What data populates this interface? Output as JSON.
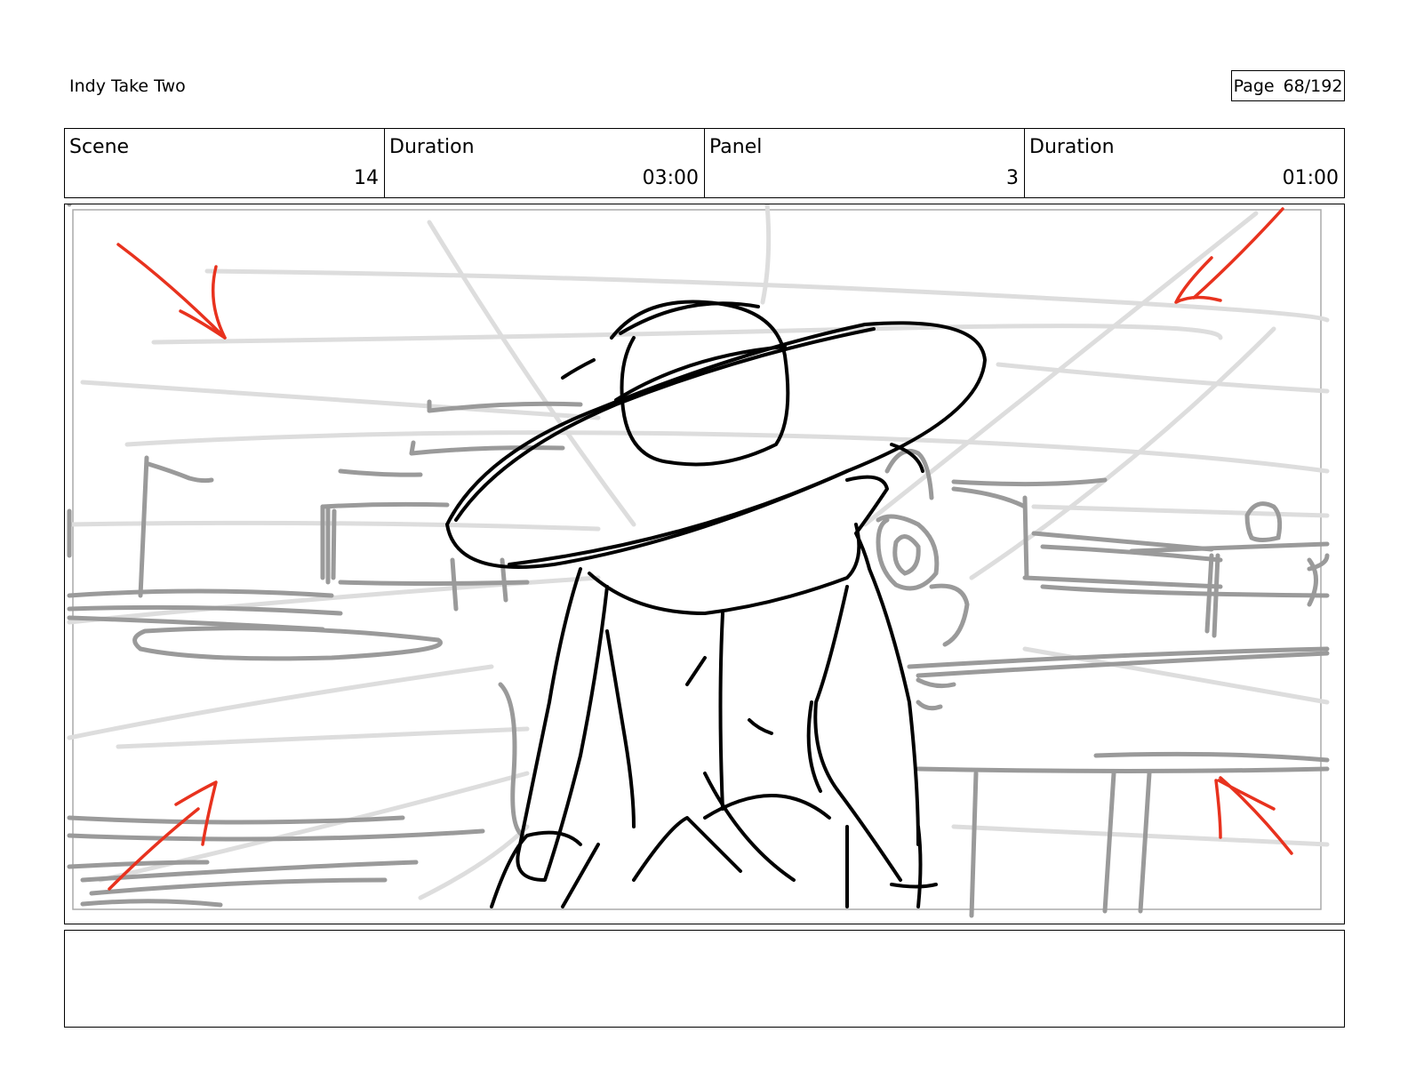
{
  "header": {
    "project_title": "Indy Take Two",
    "page_label": "Page",
    "page_number": "68/192"
  },
  "info": {
    "scene": {
      "label": "Scene",
      "value": "14"
    },
    "scene_duration": {
      "label": "Duration",
      "value": "03:00"
    },
    "panel": {
      "label": "Panel",
      "value": "3"
    },
    "panel_duration": {
      "label": "Duration",
      "value": "01:00"
    }
  },
  "notes": {
    "text": ""
  },
  "colors": {
    "sketch_black": "#000000",
    "sketch_gray": "#999999",
    "sketch_light": "#dcdcdc",
    "arrow_red": "#e8321e"
  }
}
